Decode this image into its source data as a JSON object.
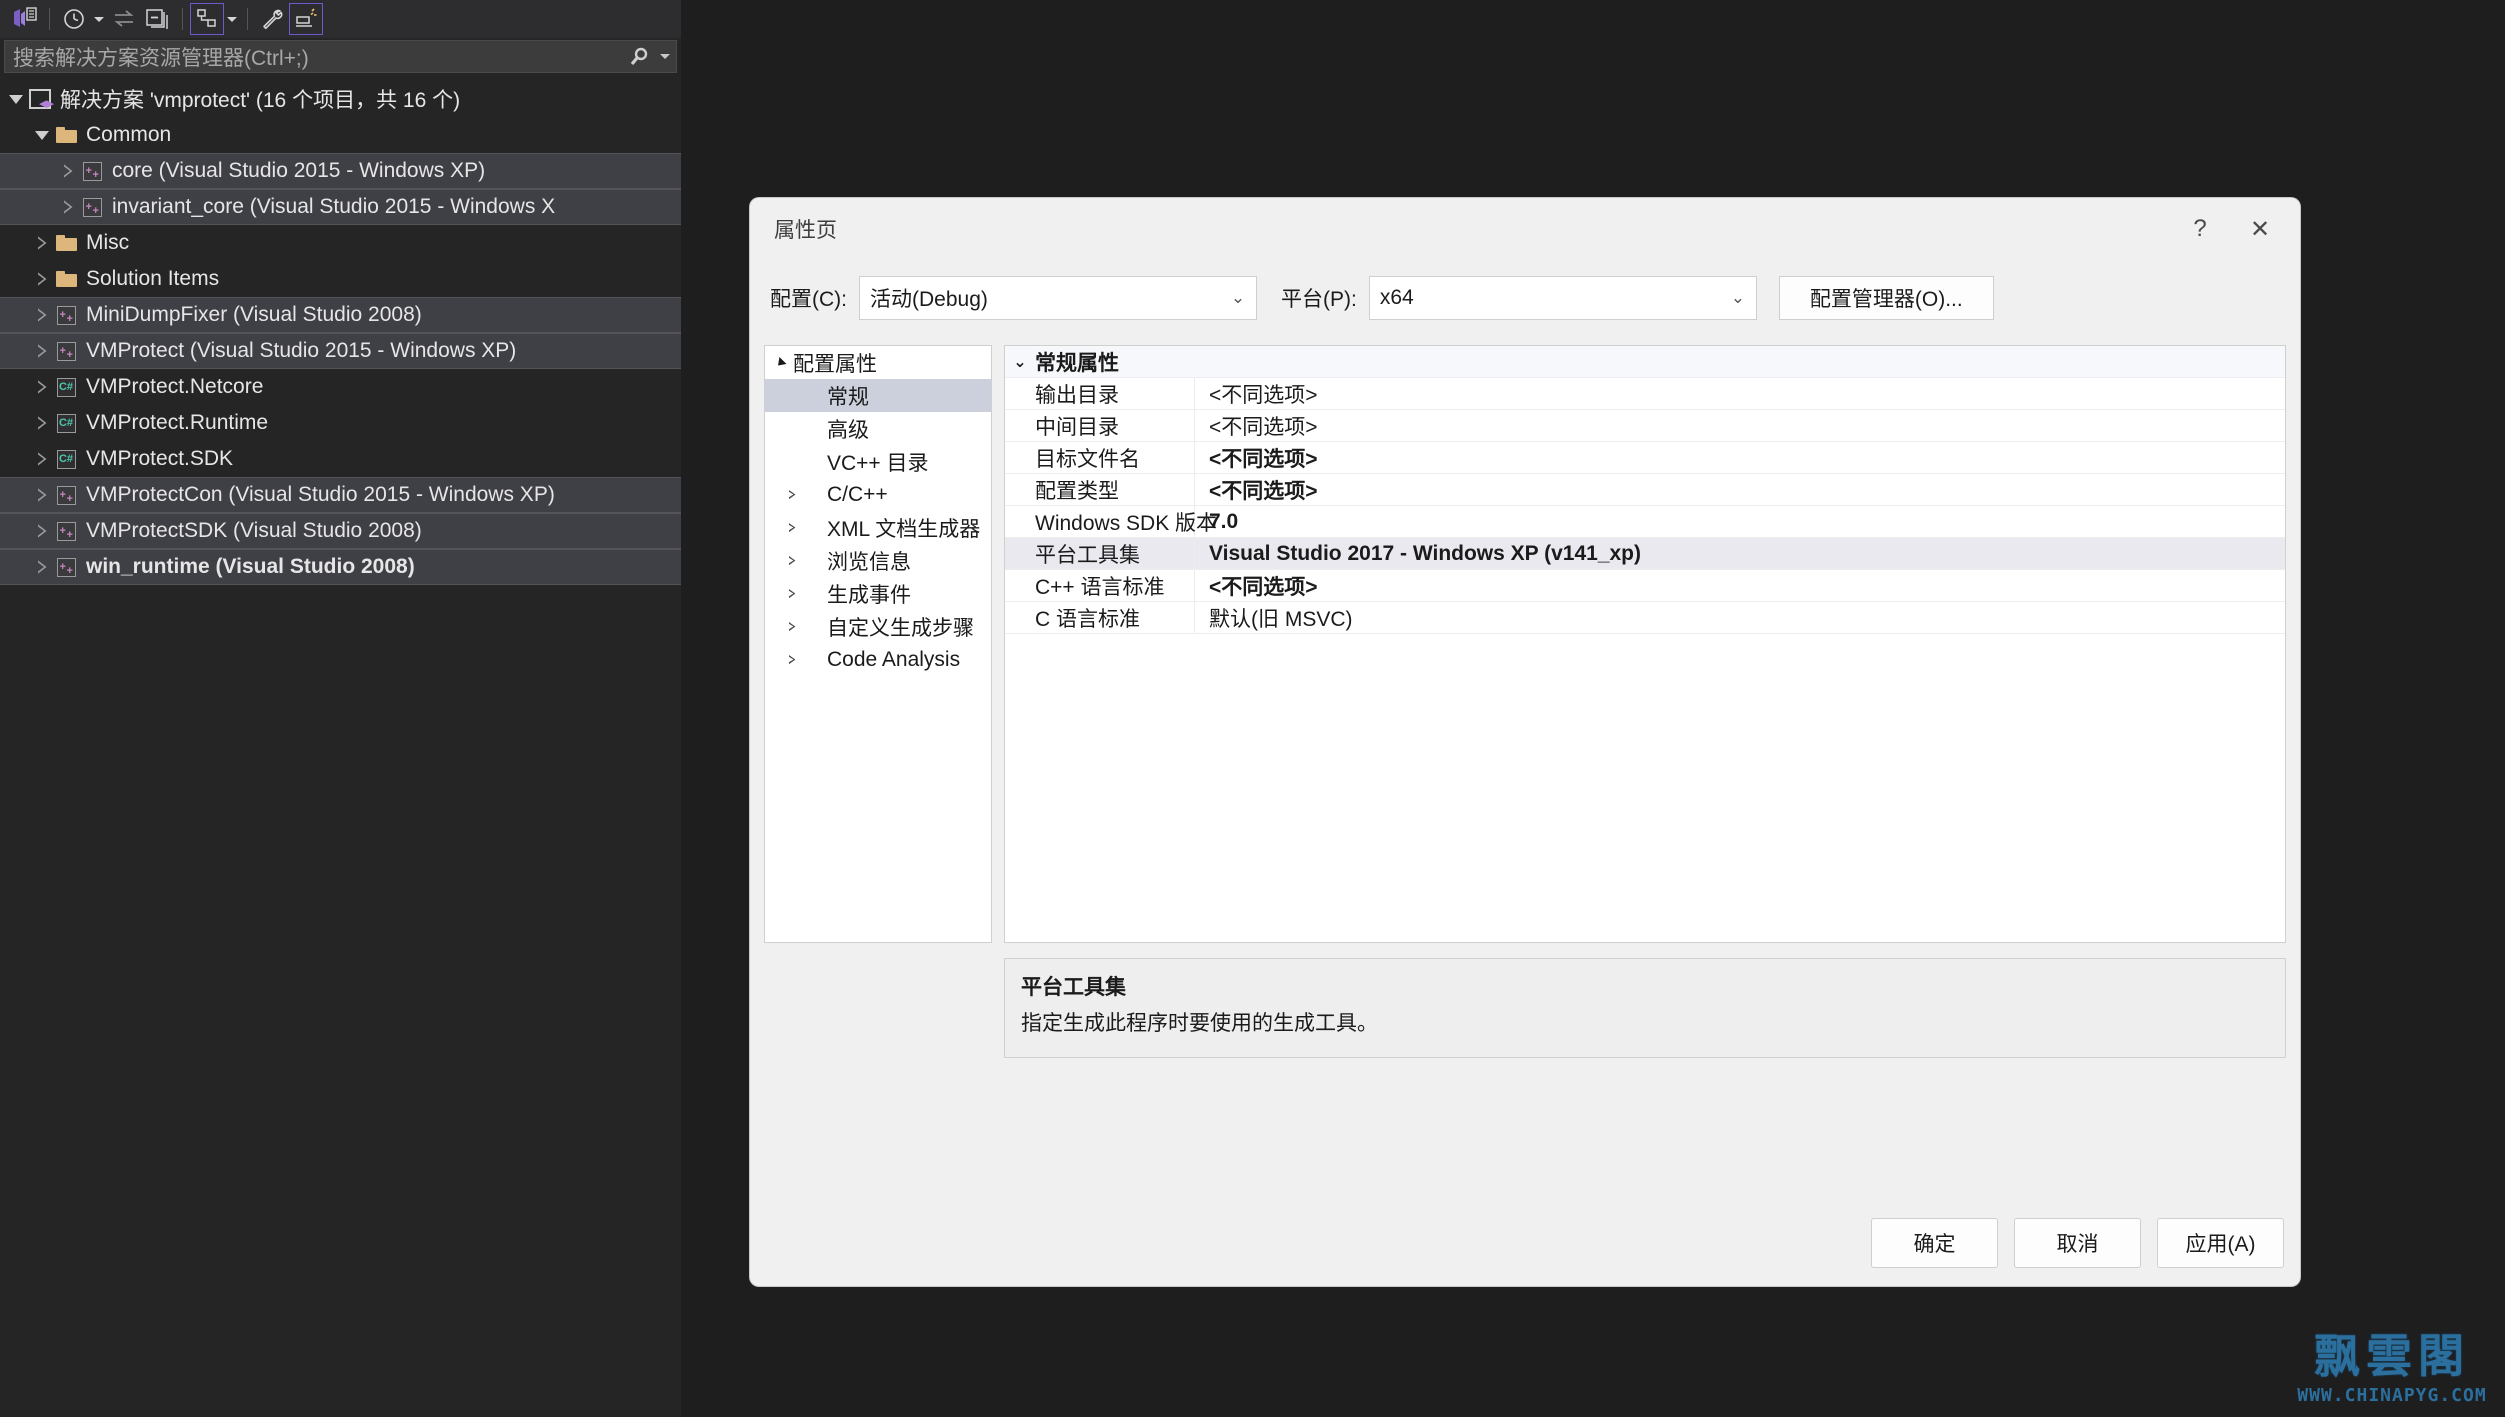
{
  "solution_explorer": {
    "toolbar": {
      "icons": [
        {
          "name": "vs-home-icon",
          "glyph": "home"
        },
        {
          "name": "pending-changes-icon",
          "glyph": "clock"
        },
        {
          "name": "pending-changes-dropdown-icon",
          "glyph": "caret-down"
        },
        {
          "name": "sync-with-active-document-icon",
          "glyph": "sync"
        },
        {
          "name": "collapse-all-icon",
          "glyph": "collapse"
        },
        {
          "name": "show-all-files-icon",
          "glyph": "files"
        },
        {
          "name": "show-all-files-dropdown-icon",
          "glyph": "caret-down"
        },
        {
          "name": "properties-icon",
          "glyph": "wrench"
        },
        {
          "name": "preview-selected-items-icon",
          "glyph": "preview"
        }
      ]
    },
    "search": {
      "placeholder": "搜索解决方案资源管理器(Ctrl+;)",
      "icon": "search-icon"
    },
    "tree": [
      {
        "label": "解决方案 'vmprotect' (16 个项目，共 16 个)",
        "icon": "solution-icon",
        "indent": 0,
        "expander": "open",
        "selected": false,
        "bold": false
      },
      {
        "label": "Common",
        "icon": "folder-icon",
        "indent": 1,
        "expander": "open",
        "selected": false,
        "bold": false
      },
      {
        "label": "core (Visual Studio 2015 - Windows XP)",
        "icon": "cpp-project-icon",
        "indent": 2,
        "expander": "closed",
        "selected": true,
        "bold": false
      },
      {
        "label": "invariant_core (Visual Studio 2015 - Windows X",
        "icon": "cpp-project-icon",
        "indent": 2,
        "expander": "closed",
        "selected": true,
        "bold": false
      },
      {
        "label": "Misc",
        "icon": "folder-icon",
        "indent": 1,
        "expander": "closed",
        "selected": false,
        "bold": false
      },
      {
        "label": "Solution Items",
        "icon": "folder-icon",
        "indent": 1,
        "expander": "closed",
        "selected": false,
        "bold": false
      },
      {
        "label": "MiniDumpFixer (Visual Studio 2008)",
        "icon": "cpp-project-icon",
        "indent": 1,
        "expander": "closed",
        "selected": true,
        "bold": false
      },
      {
        "label": "VMProtect (Visual Studio 2015 - Windows XP)",
        "icon": "cpp-project-icon",
        "indent": 1,
        "expander": "closed",
        "selected": true,
        "bold": false
      },
      {
        "label": "VMProtect.Netcore",
        "icon": "csharp-project-icon",
        "indent": 1,
        "expander": "closed",
        "selected": false,
        "bold": false
      },
      {
        "label": "VMProtect.Runtime",
        "icon": "csharp-project-icon",
        "indent": 1,
        "expander": "closed",
        "selected": false,
        "bold": false
      },
      {
        "label": "VMProtect.SDK",
        "icon": "csharp-project-icon",
        "indent": 1,
        "expander": "closed",
        "selected": false,
        "bold": false
      },
      {
        "label": "VMProtectCon (Visual Studio 2015 - Windows XP)",
        "icon": "cpp-project-icon",
        "indent": 1,
        "expander": "closed",
        "selected": true,
        "bold": false
      },
      {
        "label": "VMProtectSDK (Visual Studio 2008)",
        "icon": "cpp-project-icon",
        "indent": 1,
        "expander": "closed",
        "selected": true,
        "bold": false
      },
      {
        "label": "win_runtime (Visual Studio 2008)",
        "icon": "cpp-project-icon",
        "indent": 1,
        "expander": "closed",
        "selected": true,
        "bold": true
      }
    ]
  },
  "dialog": {
    "title": "属性页",
    "help_label": "?",
    "close_label": "✕",
    "config": {
      "config_label": "配置(C):",
      "config_value": "活动(Debug)",
      "platform_label": "平台(P):",
      "platform_value": "x64",
      "config_manager_button": "配置管理器(O)..."
    },
    "nav": [
      {
        "label": "配置属性",
        "level": 1,
        "expander": "open",
        "selected": false
      },
      {
        "label": "常规",
        "level": 2,
        "expander": "none",
        "selected": true
      },
      {
        "label": "高级",
        "level": 2,
        "expander": "none",
        "selected": false
      },
      {
        "label": "VC++ 目录",
        "level": 2,
        "expander": "none",
        "selected": false
      },
      {
        "label": "C/C++",
        "level": 2,
        "expander": "closed",
        "selected": false
      },
      {
        "label": "XML 文档生成器",
        "level": 2,
        "expander": "closed",
        "selected": false
      },
      {
        "label": "浏览信息",
        "level": 2,
        "expander": "closed",
        "selected": false
      },
      {
        "label": "生成事件",
        "level": 2,
        "expander": "closed",
        "selected": false
      },
      {
        "label": "自定义生成步骤",
        "level": 2,
        "expander": "closed",
        "selected": false
      },
      {
        "label": "Code Analysis",
        "level": 2,
        "expander": "closed",
        "selected": false
      }
    ],
    "grid": {
      "category": "常规属性",
      "rows": [
        {
          "key": "输出目录",
          "value": "<不同选项>",
          "bold": false,
          "highlight": false
        },
        {
          "key": "中间目录",
          "value": "<不同选项>",
          "bold": false,
          "highlight": false
        },
        {
          "key": "目标文件名",
          "value": "<不同选项>",
          "bold": true,
          "highlight": false
        },
        {
          "key": "配置类型",
          "value": "<不同选项>",
          "bold": true,
          "highlight": false
        },
        {
          "key": "Windows SDK 版本",
          "value": "7.0",
          "bold": true,
          "highlight": false
        },
        {
          "key": "平台工具集",
          "value": "Visual Studio 2017 - Windows XP (v141_xp)",
          "bold": true,
          "highlight": true
        },
        {
          "key": "C++ 语言标准",
          "value": "<不同选项>",
          "bold": true,
          "highlight": false
        },
        {
          "key": "C 语言标准",
          "value": "默认(旧 MSVC)",
          "bold": false,
          "highlight": false
        }
      ]
    },
    "description": {
      "title": "平台工具集",
      "body": "指定生成此程序时要使用的生成工具。"
    },
    "footer": {
      "ok": "确定",
      "cancel": "取消",
      "apply": "应用(A)"
    }
  },
  "watermark": {
    "cn": "飘雲閣",
    "url": "WWW.CHINAPYG.COM"
  },
  "colors": {
    "shell_bg": "#1e1e1e",
    "panel_bg": "#252526",
    "toolbar_bg": "#2d2d30",
    "tree_selected": "#3f3f46",
    "dialog_bg": "#f0f0f0",
    "accent_purple": "#6a5acd",
    "folder_yellow": "#dcb67a",
    "cpp_pink": "#c586c0",
    "csharp_green": "#4ec9b0",
    "nav_selected": "#cbd0dc",
    "watermark_blue": "#2b6f9e"
  }
}
